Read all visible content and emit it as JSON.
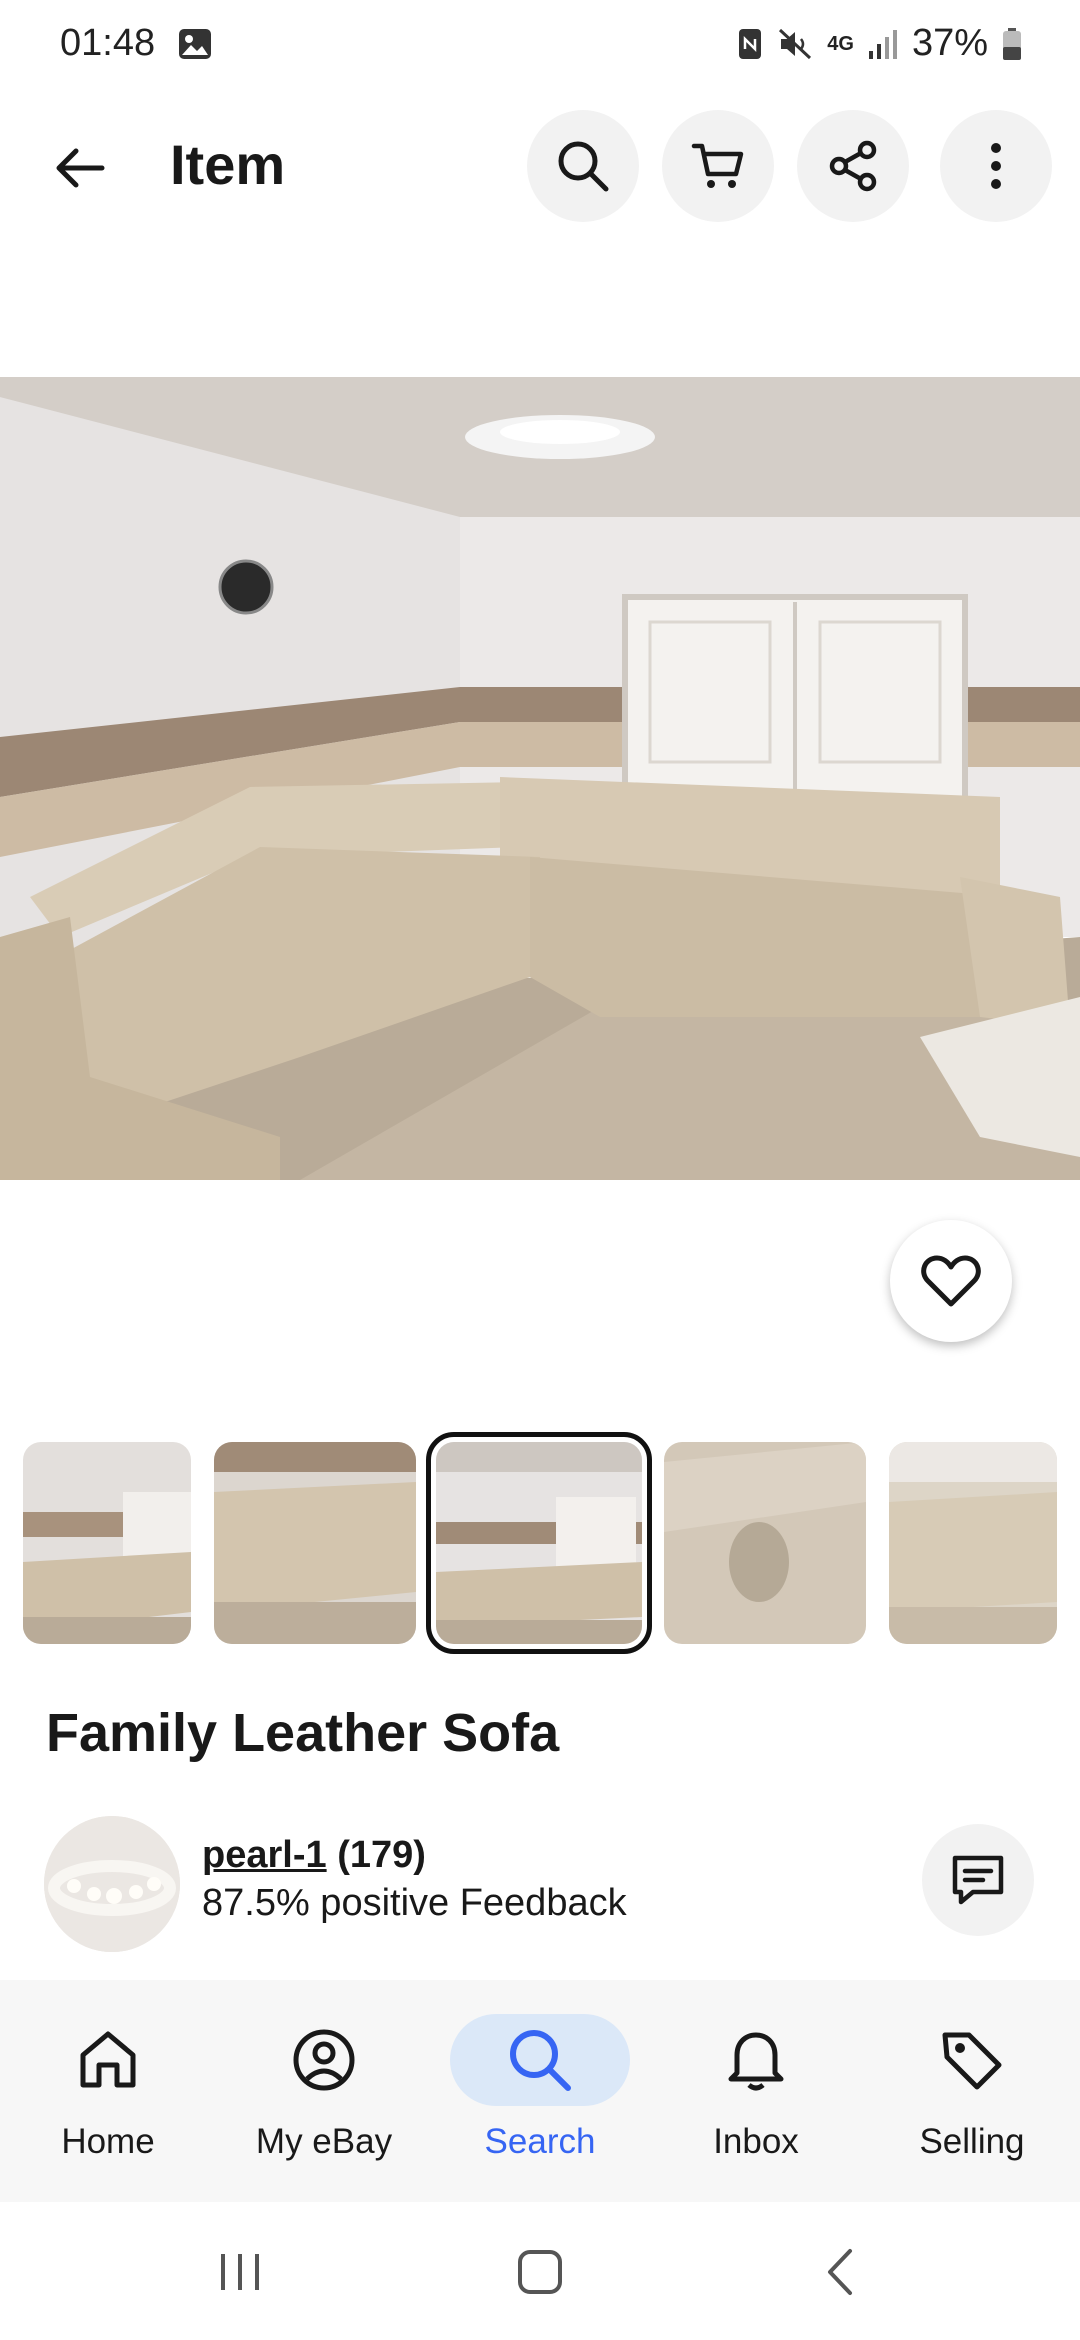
{
  "status_bar": {
    "time": "01:48",
    "network": "4G",
    "battery": "37%"
  },
  "header": {
    "title": "Item",
    "icons": [
      "back-arrow-icon",
      "search-icon",
      "cart-icon",
      "share-icon",
      "more-vertical-icon"
    ]
  },
  "item": {
    "title": "Family Leather Sofa",
    "thumbnail_count": 5,
    "selected_thumbnail": 3
  },
  "seller": {
    "name": "pearl-1",
    "feedback_count": "(179)",
    "feedback": "87.5% positive Feedback"
  },
  "bottom_nav": {
    "items": [
      {
        "label": "Home",
        "icon": "home-icon"
      },
      {
        "label": "My eBay",
        "icon": "account-icon"
      },
      {
        "label": "Search",
        "icon": "search-icon"
      },
      {
        "label": "Inbox",
        "icon": "bell-icon"
      },
      {
        "label": "Selling",
        "icon": "tag-icon"
      }
    ],
    "active": "Search"
  },
  "colors": {
    "accent": "#3665f3",
    "active_nav_bg": "#dbe8f8",
    "text": "#191919",
    "button_bg": "#f2f2f2"
  }
}
